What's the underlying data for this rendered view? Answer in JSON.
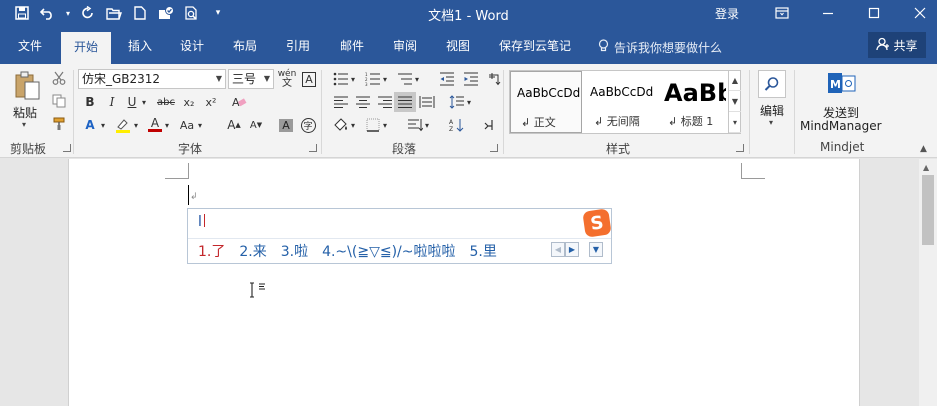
{
  "titlebar": {
    "title": "文档1 - Word",
    "login": "登录",
    "qat_icons": [
      "save-icon",
      "undo-icon",
      "redo-icon",
      "open-icon",
      "new-icon",
      "shield-check-icon",
      "print-preview-icon",
      "customize-icon"
    ],
    "window_icons": [
      "ribbon-display-icon",
      "minimize-icon",
      "maximize-icon",
      "close-icon"
    ]
  },
  "tabs": [
    "文件",
    "开始",
    "插入",
    "设计",
    "布局",
    "引用",
    "邮件",
    "审阅",
    "视图",
    "保存到云笔记"
  ],
  "active_tab": "开始",
  "tell_me": "告诉我你想要做什么",
  "share_label": "共享",
  "clipboard": {
    "paste_label": "粘贴",
    "group_label": "剪贴板"
  },
  "font": {
    "name": "仿宋_GB2312",
    "size": "三号",
    "phonetic": "wén",
    "group_label": "字体",
    "buttons": [
      "B",
      "I",
      "U",
      "abc",
      "x₂",
      "x²",
      "A",
      "Aa",
      "A",
      "A",
      "A",
      "字"
    ]
  },
  "paragraph": {
    "group_label": "段落"
  },
  "styles": {
    "group_label": "样式",
    "items": [
      {
        "preview": "AaBbCcDd",
        "name": "正文"
      },
      {
        "preview": "AaBbCcDd",
        "name": "无间隔"
      },
      {
        "preview": "AaBb",
        "name": "标题 1"
      }
    ]
  },
  "editing": {
    "label": "编辑"
  },
  "mindjet": {
    "send_label_1": "发送到",
    "send_label_2": "MindManager",
    "group_label": "Mindjet"
  },
  "ime": {
    "composition": "l",
    "logo": "S",
    "candidates": [
      "1.了",
      "2.来",
      "3.啦",
      "4.~\\(≧▽≦)/~啦啦啦",
      "5.里"
    ]
  },
  "colors": {
    "title_bar": "#2b579a",
    "ribbon": "#f3f3f3",
    "ime_logo": "#f46f2e",
    "candidate_first": "#c3272b",
    "candidate": "#2460a8"
  }
}
